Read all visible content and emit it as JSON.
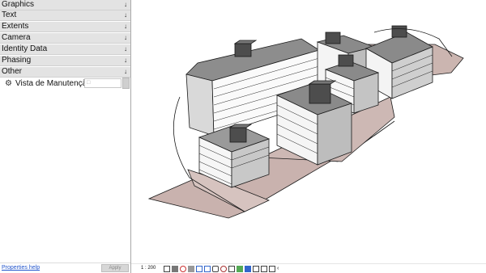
{
  "properties_panel": {
    "categories": [
      {
        "label": "Graphics"
      },
      {
        "label": "Text"
      },
      {
        "label": "Extents"
      },
      {
        "label": "Camera"
      },
      {
        "label": "Identity Data"
      },
      {
        "label": "Phasing"
      },
      {
        "label": "Other"
      }
    ],
    "chevron_icon": "double-chevron-down-icon",
    "vista_row": {
      "icon": "gear-icon",
      "label": "Vista de Manutenção",
      "value": ""
    },
    "help_link": "Properties help",
    "apply_label": "Apply"
  },
  "viewport": {
    "content": "3D axonometric model of buildings",
    "colors": {
      "site": "#c9b2ae",
      "building_light": "#f2f2f2",
      "building_dark": "#8a8a8a",
      "roof_block": "#4d4d4d",
      "edge": "#1a1a1a"
    }
  },
  "status_bar": {
    "scale": "1 : 200",
    "icons": [
      "detail-level-icon",
      "visual-style-icon",
      "sun-path-icon",
      "shadows-icon",
      "crop-icon",
      "show-crop-icon",
      "lock-3d-icon",
      "temp-hide-icon",
      "reveal-hidden-icon",
      "analytical-icon",
      "highlight-icon",
      "worksharing-icon",
      "constraints-icon",
      "design-options-icon",
      "collapse-icon"
    ]
  }
}
